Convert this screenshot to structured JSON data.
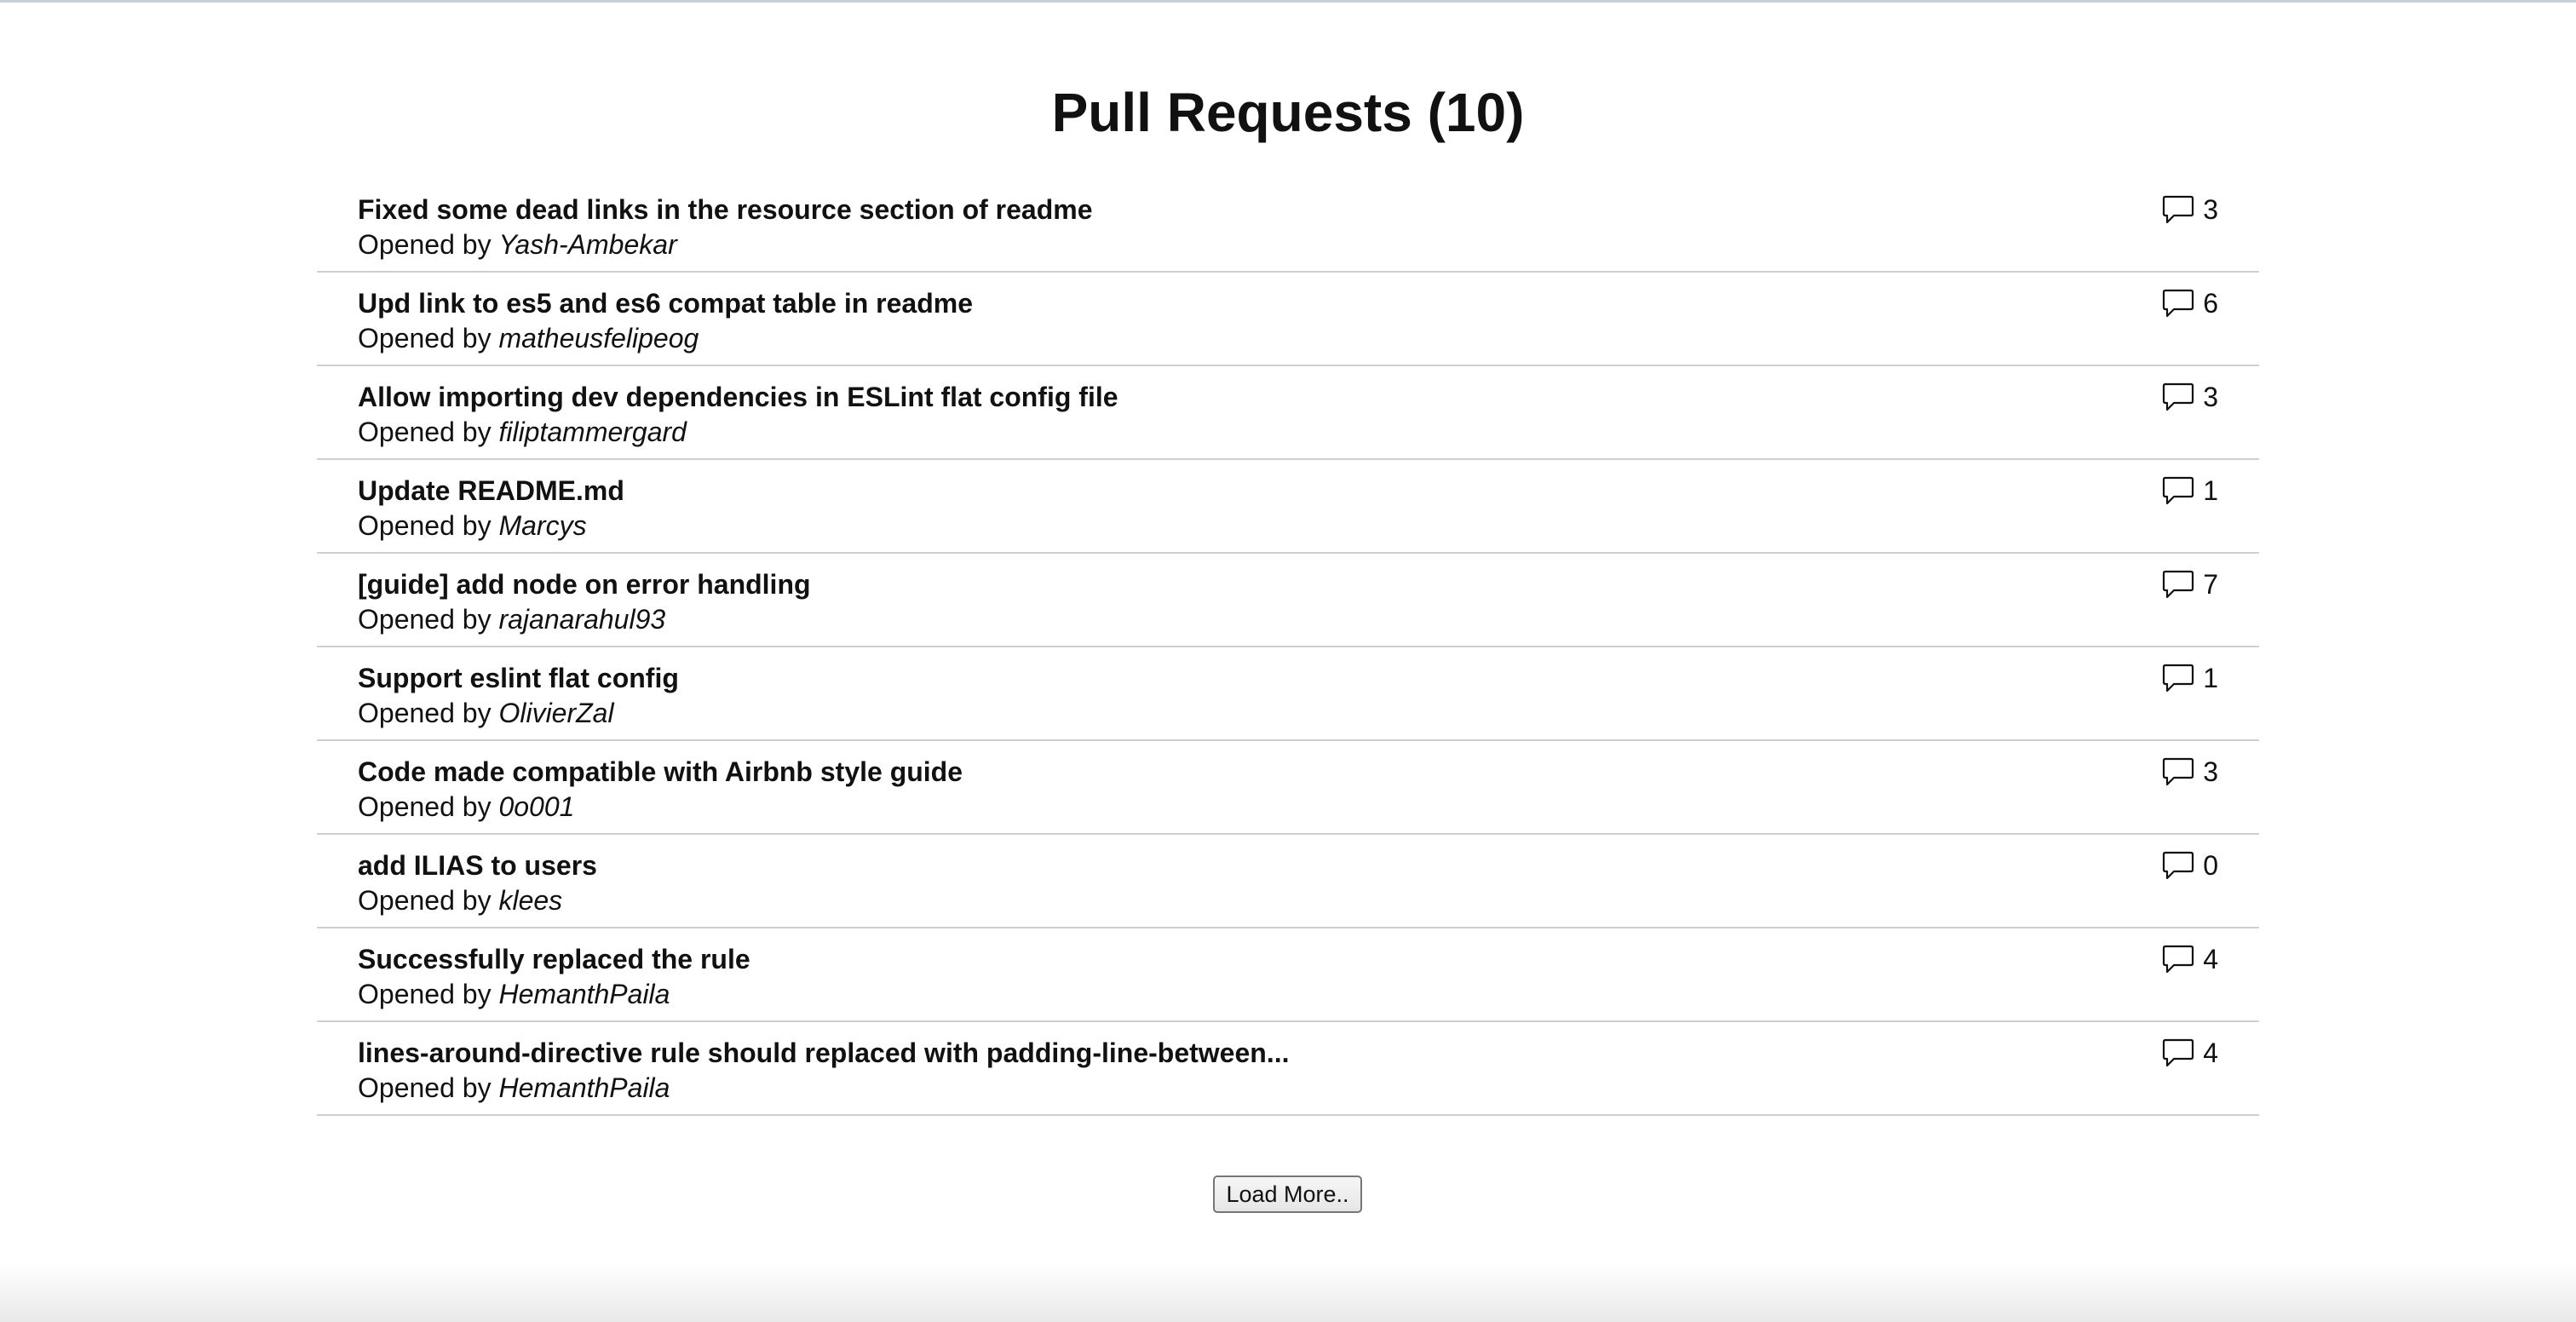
{
  "page": {
    "title": "Pull Requests (10)"
  },
  "pull_requests": [
    {
      "title": "Fixed some dead links in the resource section of readme",
      "opened_by_label": "Opened by",
      "author": "Yash-Ambekar",
      "comments": "3"
    },
    {
      "title": "Upd link to es5 and es6 compat table in readme",
      "opened_by_label": "Opened by",
      "author": "matheusfelipeog",
      "comments": "6"
    },
    {
      "title": "Allow importing dev dependencies in ESLint flat config file",
      "opened_by_label": "Opened by",
      "author": "filiptammergard",
      "comments": "3"
    },
    {
      "title": "Update README.md",
      "opened_by_label": "Opened by",
      "author": "Marcys",
      "comments": "1"
    },
    {
      "title": "[guide] add node on error handling",
      "opened_by_label": "Opened by",
      "author": "rajanarahul93",
      "comments": "7"
    },
    {
      "title": "Support eslint flat config",
      "opened_by_label": "Opened by",
      "author": "OlivierZal",
      "comments": "1"
    },
    {
      "title": "Code made compatible with Airbnb style guide",
      "opened_by_label": "Opened by",
      "author": "0o001",
      "comments": "3"
    },
    {
      "title": "add ILIAS to users",
      "opened_by_label": "Opened by",
      "author": "klees",
      "comments": "0"
    },
    {
      "title": "Successfully replaced the rule",
      "opened_by_label": "Opened by",
      "author": "HemanthPaila",
      "comments": "4"
    },
    {
      "title": "lines-around-directive rule should replaced with padding-line-between...",
      "opened_by_label": "Opened by",
      "author": "HemanthPaila",
      "comments": "4"
    }
  ],
  "icons": {
    "comment": "comment-icon"
  },
  "actions": {
    "load_more_label": "Load More.."
  },
  "colors": {
    "text": "#111111",
    "divider": "#cfcfcf",
    "background": "#ffffff"
  }
}
